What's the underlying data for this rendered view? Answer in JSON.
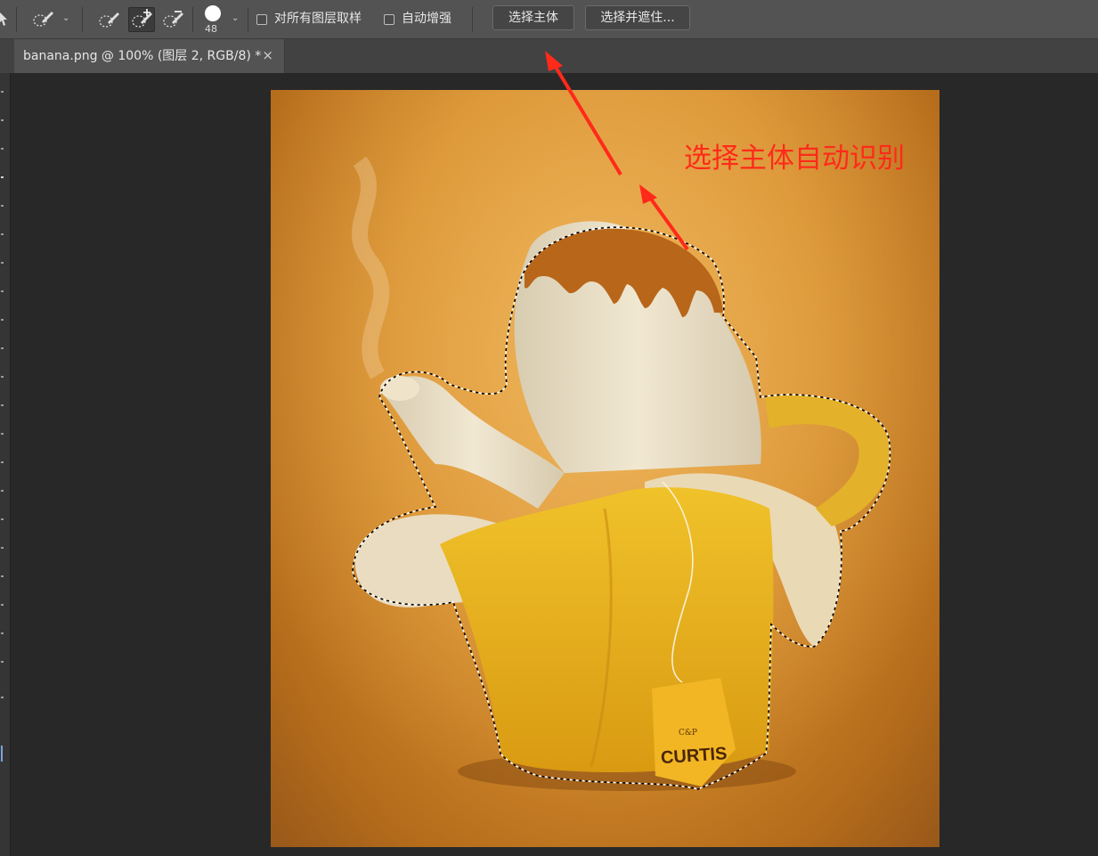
{
  "toolbar": {
    "brush_size": "48",
    "sample_all_layers_label": "对所有图层取样",
    "sample_all_layers_checked": false,
    "auto_enhance_label": "自动增强",
    "auto_enhance_checked": false,
    "select_subject_label": "选择主体",
    "select_and_mask_label": "选择并遮住..."
  },
  "document_tab": {
    "title": "banana.png @ 100% (图层 2, RGB/8) *",
    "close_glyph": "×"
  },
  "annotation": {
    "text": "选择主体自动识别",
    "color": "#ff2a1a"
  },
  "canvas": {
    "tea_tag_text": "CURTIS",
    "tea_tag_small_text": "C&P",
    "background_color": "#d78f2e"
  },
  "icons": [
    "move-tool-icon",
    "quick-selection-preset-icon",
    "new-selection-icon",
    "add-to-selection-icon",
    "subtract-from-selection-icon",
    "brush-size-icon"
  ]
}
